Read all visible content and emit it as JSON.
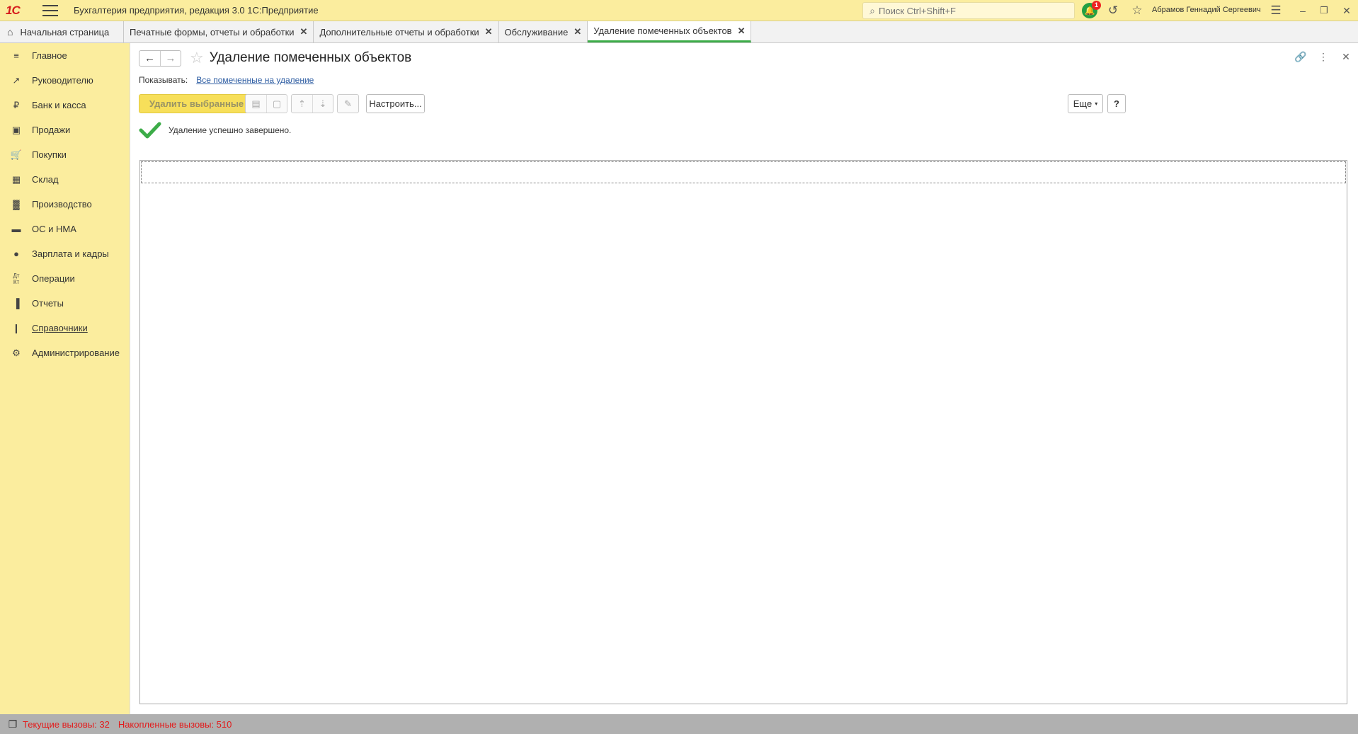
{
  "window": {
    "logo": "1С",
    "title": "Бухгалтерия предприятия, редакция 3.0 1С:Предприятие",
    "search_placeholder": "Поиск Ctrl+Shift+F",
    "notifications_count": "1",
    "user_name": "Абрамов Геннадий Сергеевич"
  },
  "tabs": {
    "home": "Начальная страница",
    "items": [
      {
        "label": "Печатные формы, отчеты и обработки"
      },
      {
        "label": "Дополнительные отчеты и обработки"
      },
      {
        "label": "Обслуживание"
      },
      {
        "label": "Удаление помеченных объектов"
      }
    ]
  },
  "sidebar": {
    "items": [
      {
        "label": "Главное",
        "icon": "menu-icon"
      },
      {
        "label": "Руководителю",
        "icon": "trend-icon"
      },
      {
        "label": "Банк и касса",
        "icon": "ruble-icon"
      },
      {
        "label": "Продажи",
        "icon": "bag-icon"
      },
      {
        "label": "Покупки",
        "icon": "cart-icon"
      },
      {
        "label": "Склад",
        "icon": "warehouse-icon"
      },
      {
        "label": "Производство",
        "icon": "factory-icon"
      },
      {
        "label": "ОС и НМА",
        "icon": "truck-icon"
      },
      {
        "label": "Зарплата и кадры",
        "icon": "person-icon"
      },
      {
        "label": "Операции",
        "icon": "dt-kt-icon"
      },
      {
        "label": "Отчеты",
        "icon": "bar-chart-icon"
      },
      {
        "label": "Справочники",
        "icon": "books-icon"
      },
      {
        "label": "Администрирование",
        "icon": "gear-icon"
      }
    ]
  },
  "form": {
    "title": "Удаление помеченных объектов",
    "show_label": "Показывать:",
    "show_link": "Все помеченные на удаление",
    "delete_button": "Удалить выбранные",
    "settings_button": "Настроить...",
    "more_button": "Еще",
    "help_button": "?",
    "status_message": "Удаление успешно завершено."
  },
  "statusbar": {
    "current_calls": "Текущие вызовы: 32",
    "accumulated_calls": "Накопленные вызовы: 510"
  },
  "colors": {
    "accent_yellow": "#fbed9e",
    "primary_button": "#f7df5a",
    "active_tab_underline": "#3cac48",
    "success_green": "#3cac48",
    "status_red": "#e21b1b"
  }
}
